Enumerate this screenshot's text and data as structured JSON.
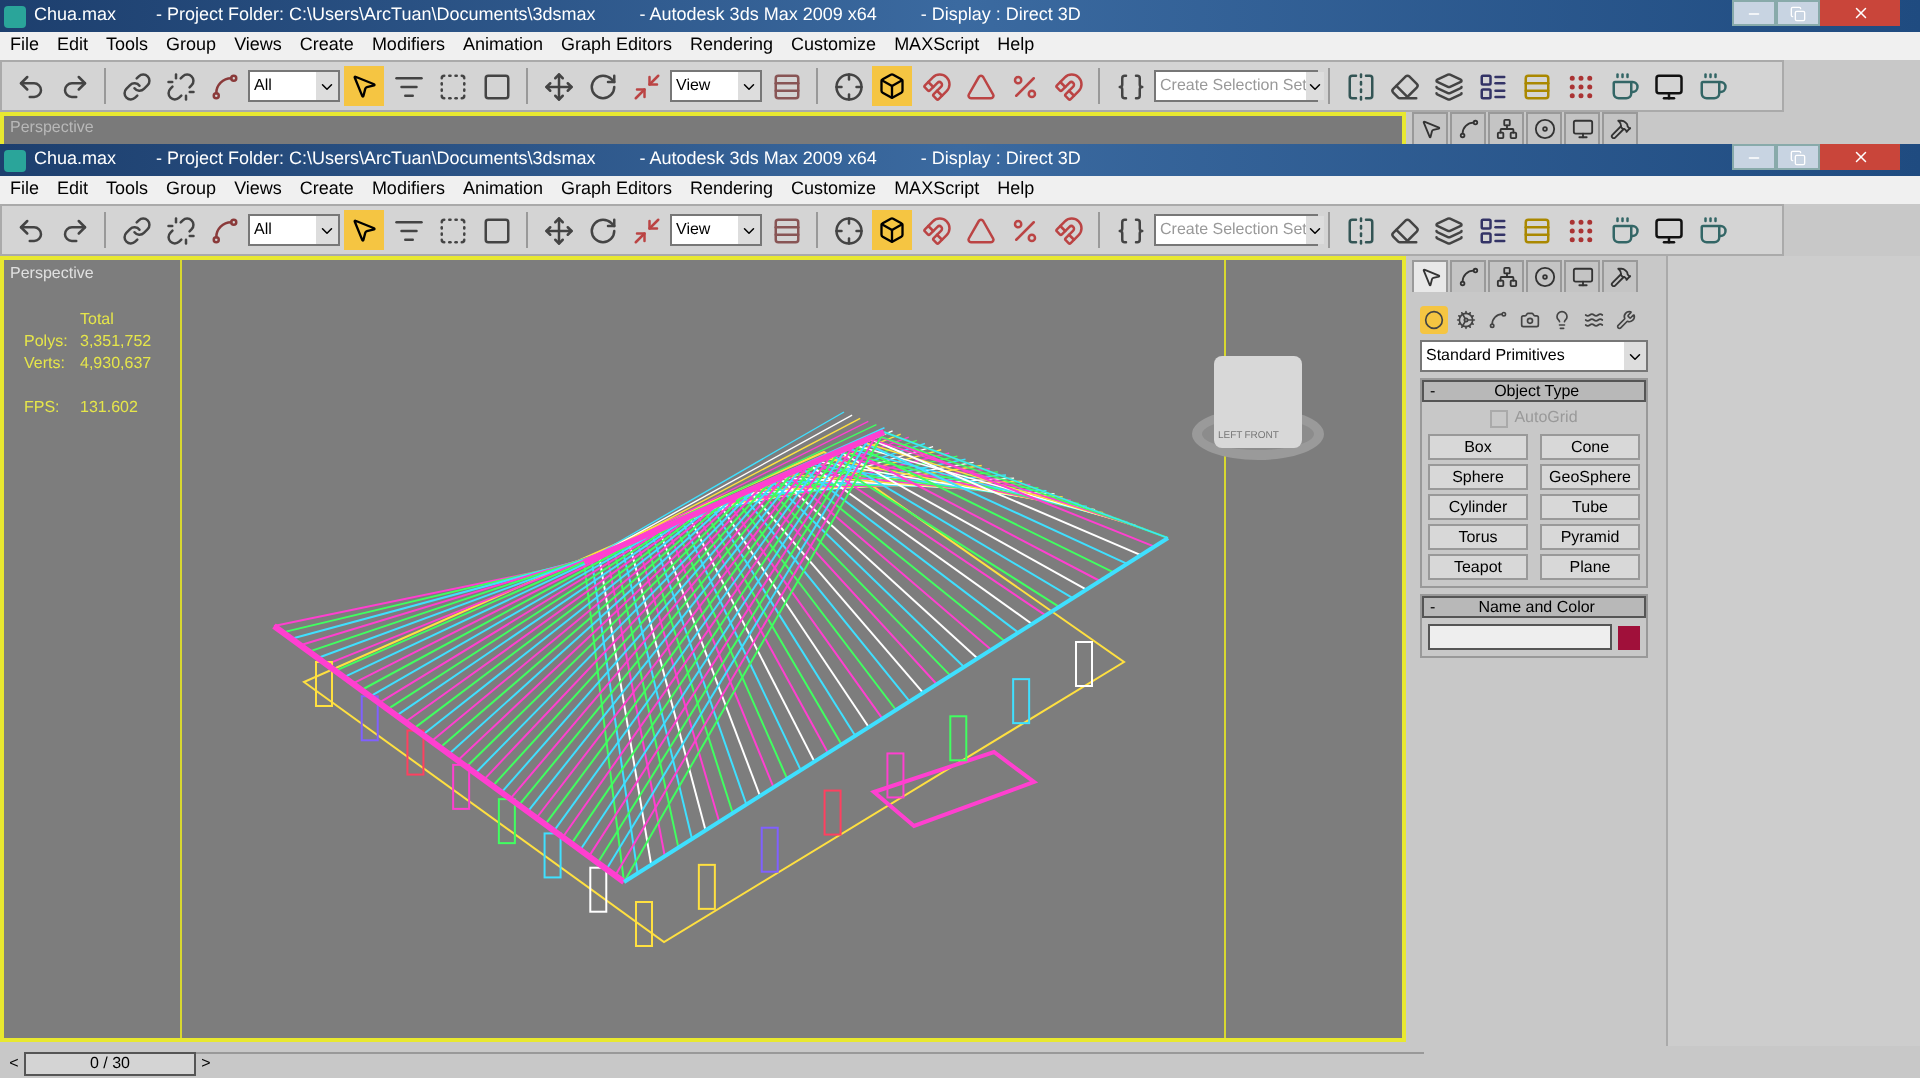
{
  "windows": [
    {
      "title": {
        "file": "Chua.max",
        "project": "- Project Folder: C:\\Users\\ArcTuan\\Documents\\3dsmax",
        "app": "- Autodesk 3ds Max  2009 x64",
        "display": "- Display : Direct 3D"
      },
      "menu": [
        "File",
        "Edit",
        "Tools",
        "Group",
        "Views",
        "Create",
        "Modifiers",
        "Animation",
        "Graph Editors",
        "Rendering",
        "Customize",
        "MAXScript",
        "Help"
      ],
      "toolbar": {
        "filter": "All",
        "coord": "View",
        "selection_set": {
          "placeholder": "Create Selection Set"
        },
        "select_pressed": true,
        "snap_pressed": true
      },
      "viewport": {
        "label": "Perspective"
      },
      "command_tabs": [
        {
          "selected": false
        },
        {
          "selected": false
        },
        {
          "selected": false
        },
        {
          "selected": false
        },
        {
          "selected": false
        },
        {
          "selected": false
        }
      ]
    },
    {
      "title": {
        "file": "Chua.max",
        "project": "- Project Folder: C:\\Users\\ArcTuan\\Documents\\3dsmax",
        "app": "- Autodesk 3ds Max  2009 x64",
        "display": "- Display : Direct 3D"
      },
      "menu": [
        "File",
        "Edit",
        "Tools",
        "Group",
        "Views",
        "Create",
        "Modifiers",
        "Animation",
        "Graph Editors",
        "Rendering",
        "Customize",
        "MAXScript",
        "Help"
      ],
      "toolbar": {
        "filter": "All",
        "coord": "View",
        "selection_set": {
          "placeholder": "Create Selection Set"
        },
        "select_pressed": true,
        "snap_pressed": true
      },
      "viewport": {
        "label": "Perspective",
        "stats": {
          "header": "Total",
          "rows": [
            {
              "label": "Polys:",
              "value": "3,351,752"
            },
            {
              "label": "Verts:",
              "value": "4,930,637"
            }
          ],
          "fps_label": "FPS:",
          "fps": "131.602"
        },
        "viewcube": {
          "left": "LEFT",
          "front": "FRONT"
        }
      },
      "command_tabs": [
        {
          "selected": true
        },
        {
          "selected": false
        },
        {
          "selected": false
        },
        {
          "selected": false
        },
        {
          "selected": false
        },
        {
          "selected": false
        }
      ],
      "create_categories": [
        {
          "selected": true
        },
        {
          "selected": false
        },
        {
          "selected": false
        },
        {
          "selected": false
        },
        {
          "selected": false
        },
        {
          "selected": false
        },
        {
          "selected": false
        }
      ],
      "primitive_type": "Standard Primitives",
      "object_type": {
        "title": "Object Type",
        "collapse": "-",
        "autogrid": {
          "label": "AutoGrid",
          "checked": false,
          "disabled": true
        },
        "buttons": [
          "Box",
          "Cone",
          "Sphere",
          "GeoSphere",
          "Cylinder",
          "Tube",
          "Torus",
          "Pyramid",
          "Teapot",
          "Plane"
        ]
      },
      "name_and_color": {
        "title": "Name and Color",
        "collapse": "-",
        "color": "#a0103a"
      },
      "timeline": {
        "prev": "<",
        "frame": "0 / 30",
        "next": ">"
      }
    }
  ]
}
